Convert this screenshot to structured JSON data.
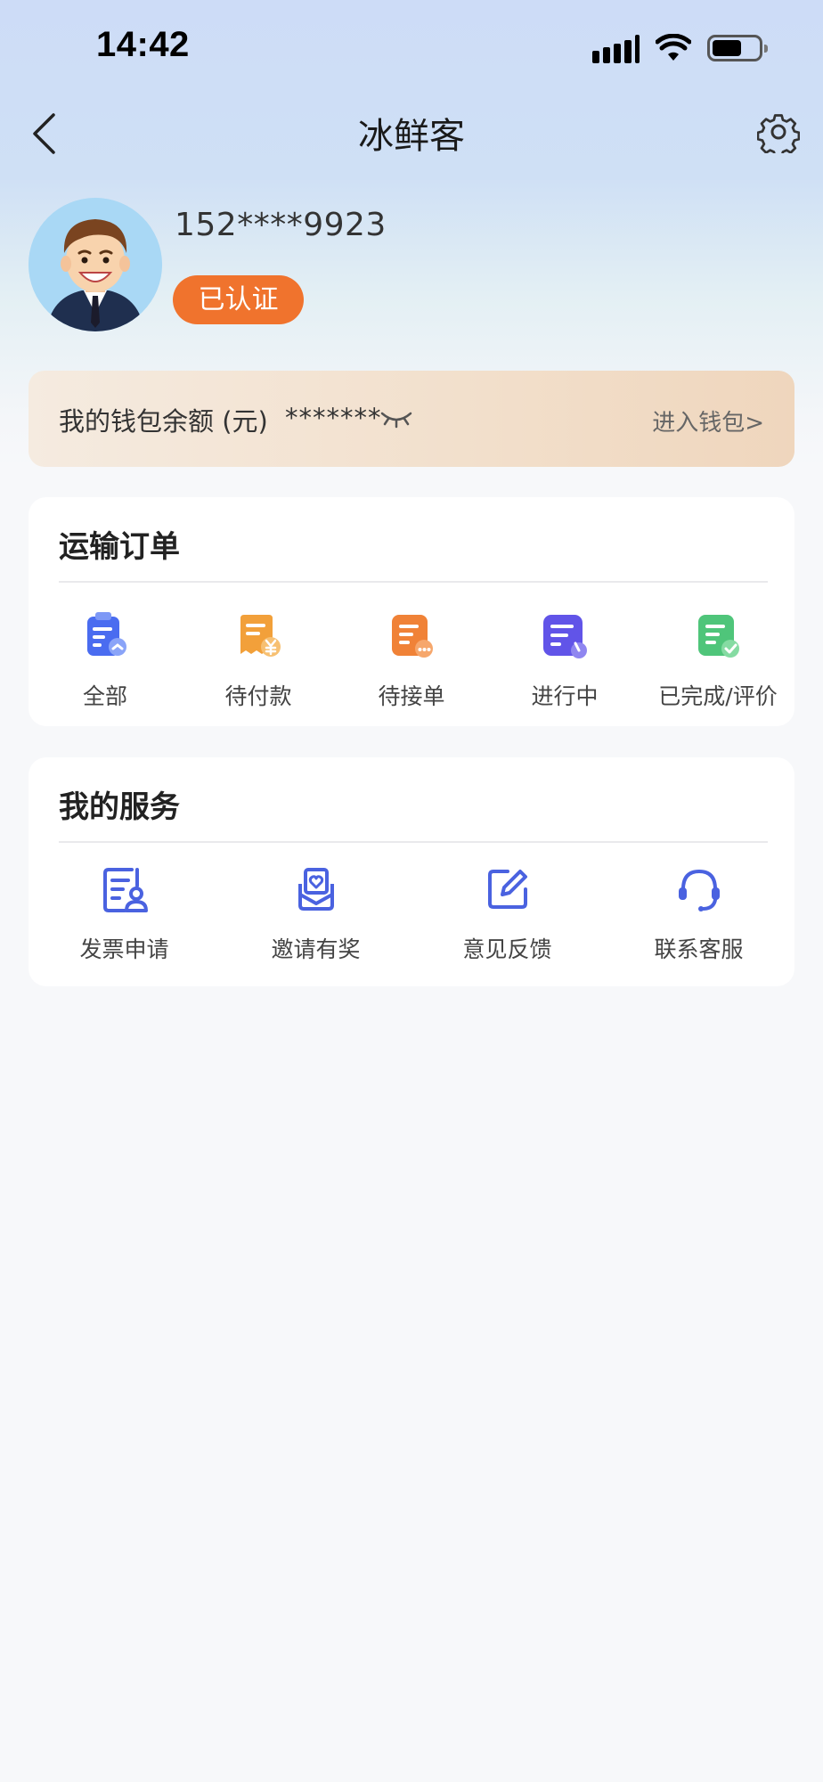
{
  "status_bar": {
    "time": "14:42"
  },
  "nav": {
    "title": "冰鲜客"
  },
  "profile": {
    "phone": "152****9923",
    "verified_label": "已认证"
  },
  "wallet": {
    "label": "我的钱包余额 (元)",
    "masked_balance": "*******",
    "enter_label": "进入钱包>"
  },
  "orders": {
    "title": "运输订单",
    "items": [
      {
        "label": "全部",
        "icon": "all-orders-icon",
        "color": "#4a6cf0"
      },
      {
        "label": "待付款",
        "icon": "pending-payment-icon",
        "color": "#f2a03a"
      },
      {
        "label": "待接单",
        "icon": "pending-accept-icon",
        "color": "#f08237"
      },
      {
        "label": "进行中",
        "icon": "in-progress-icon",
        "color": "#6154e8"
      },
      {
        "label": "已完成/评价",
        "icon": "completed-icon",
        "color": "#4fc57a"
      }
    ]
  },
  "services": {
    "title": "我的服务",
    "items": [
      {
        "label": "发票申请",
        "icon": "invoice-icon"
      },
      {
        "label": "邀请有奖",
        "icon": "invite-reward-icon"
      },
      {
        "label": "意见反馈",
        "icon": "feedback-icon"
      },
      {
        "label": "联系客服",
        "icon": "customer-service-icon"
      }
    ],
    "icon_color": "#4a62e0"
  },
  "colors": {
    "accent_orange": "#f0732d",
    "hero_blue": "#cddcf7"
  }
}
